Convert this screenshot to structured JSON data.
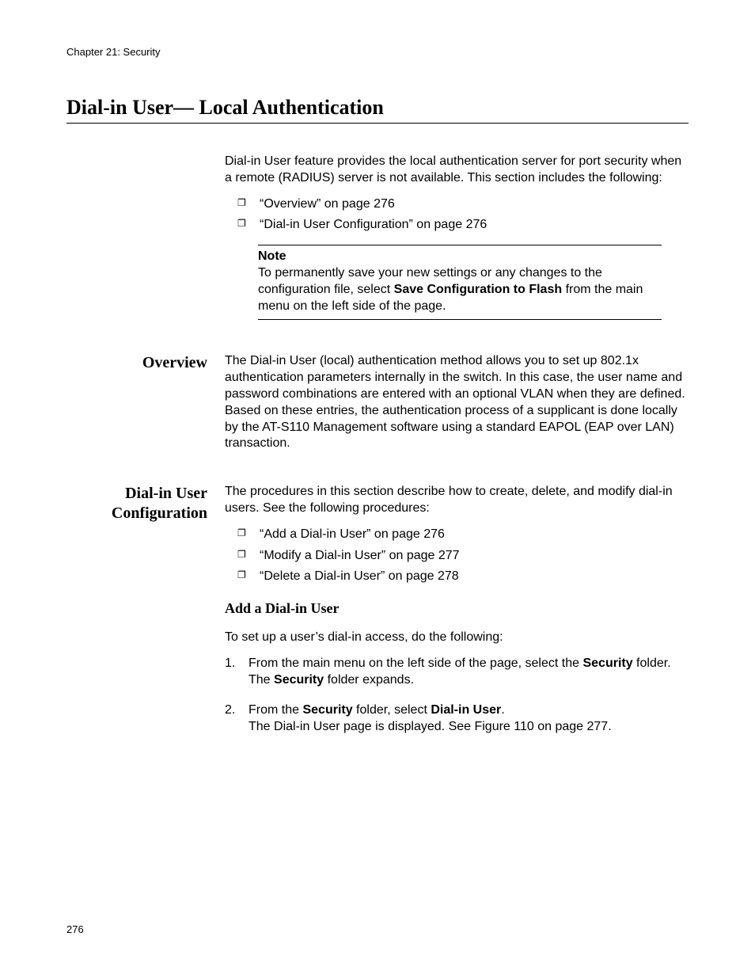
{
  "chapter_header": "Chapter 21: Security",
  "page_title": "Dial-in User— Local Authentication",
  "intro": {
    "text": "Dial-in User feature provides the local authentication server for port security when a remote (RADIUS) server is not available. This section includes the following:",
    "bullets": [
      "“Overview” on page 276",
      "“Dial-in User Configuration” on page 276"
    ]
  },
  "note": {
    "label": "Note",
    "pre": "To permanently save your new settings or any changes to the configuration file, select ",
    "bold": "Save Configuration to Flash",
    "post": " from the main menu on the left side of the page."
  },
  "overview": {
    "label": "Overview",
    "text": "The Dial-in User (local) authentication method allows you to set up 802.1x authentication parameters internally in the switch. In this case, the user name and password combinations are entered with an optional VLAN when they are defined. Based on these entries, the authentication process of a supplicant is done locally by the AT-S110 Management software using a standard EAPOL (EAP over LAN) transaction."
  },
  "config": {
    "label": "Dial-in User Configuration",
    "intro": "The procedures in this section describe how to create, delete, and modify dial-in users. See the following procedures:",
    "bullets": [
      "“Add a Dial-in User” on page 276",
      "“Modify a Dial-in User” on page 277",
      "“Delete a Dial-in User” on page 278"
    ],
    "subheading": "Add a Dial-in User",
    "subintro": "To set up a user’s dial-in access, do the following:",
    "steps": {
      "s1_a": "From the main menu on the left side of the page, select the ",
      "s1_bold": "Security",
      "s1_b": " folder.",
      "s1_c1": "The ",
      "s1_c_bold": "Security",
      "s1_c2": " folder expands.",
      "s2_a": "From the ",
      "s2_bold1": "Security",
      "s2_b": " folder, select ",
      "s2_bold2": "Dial-in User",
      "s2_c": ".",
      "s2_d": "The Dial-in User page is displayed. See Figure 110 on page 277."
    }
  },
  "page_number": "276"
}
